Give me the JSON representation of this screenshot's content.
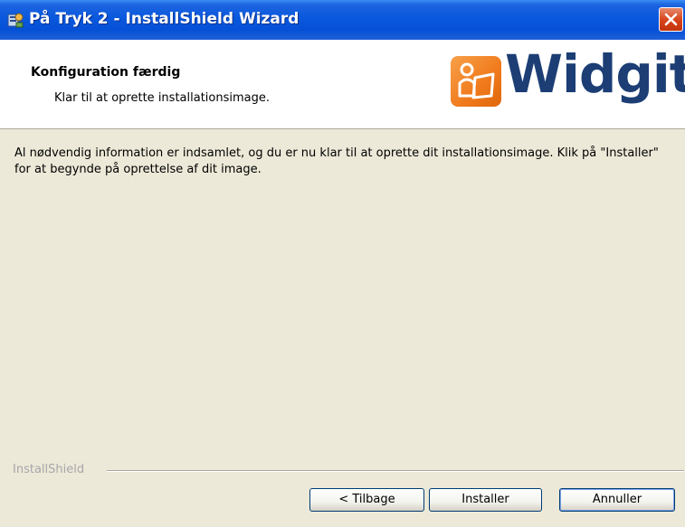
{
  "window": {
    "title": "På Tryk 2 - InstallShield Wizard"
  },
  "header": {
    "title": "Konfiguration færdig",
    "subtitle": "Klar til at oprette installationsimage.",
    "logo_text": "Widgit"
  },
  "main": {
    "description": "Al nødvendig information er indsamlet, og du er nu klar til at oprette dit installationsimage. Klik på \"Installer\" for at begynde på oprettelse af dit image."
  },
  "footer": {
    "brand": "InstallShield",
    "back_label": "< Tilbage",
    "install_label": "Installer",
    "cancel_label": "Annuller"
  },
  "colors": {
    "titlebar": "#0A58DD",
    "close": "#D9461C",
    "logo_orange": "#F07A1B",
    "logo_navy": "#1C3E75",
    "dialog_bg": "#ECE9D8"
  }
}
